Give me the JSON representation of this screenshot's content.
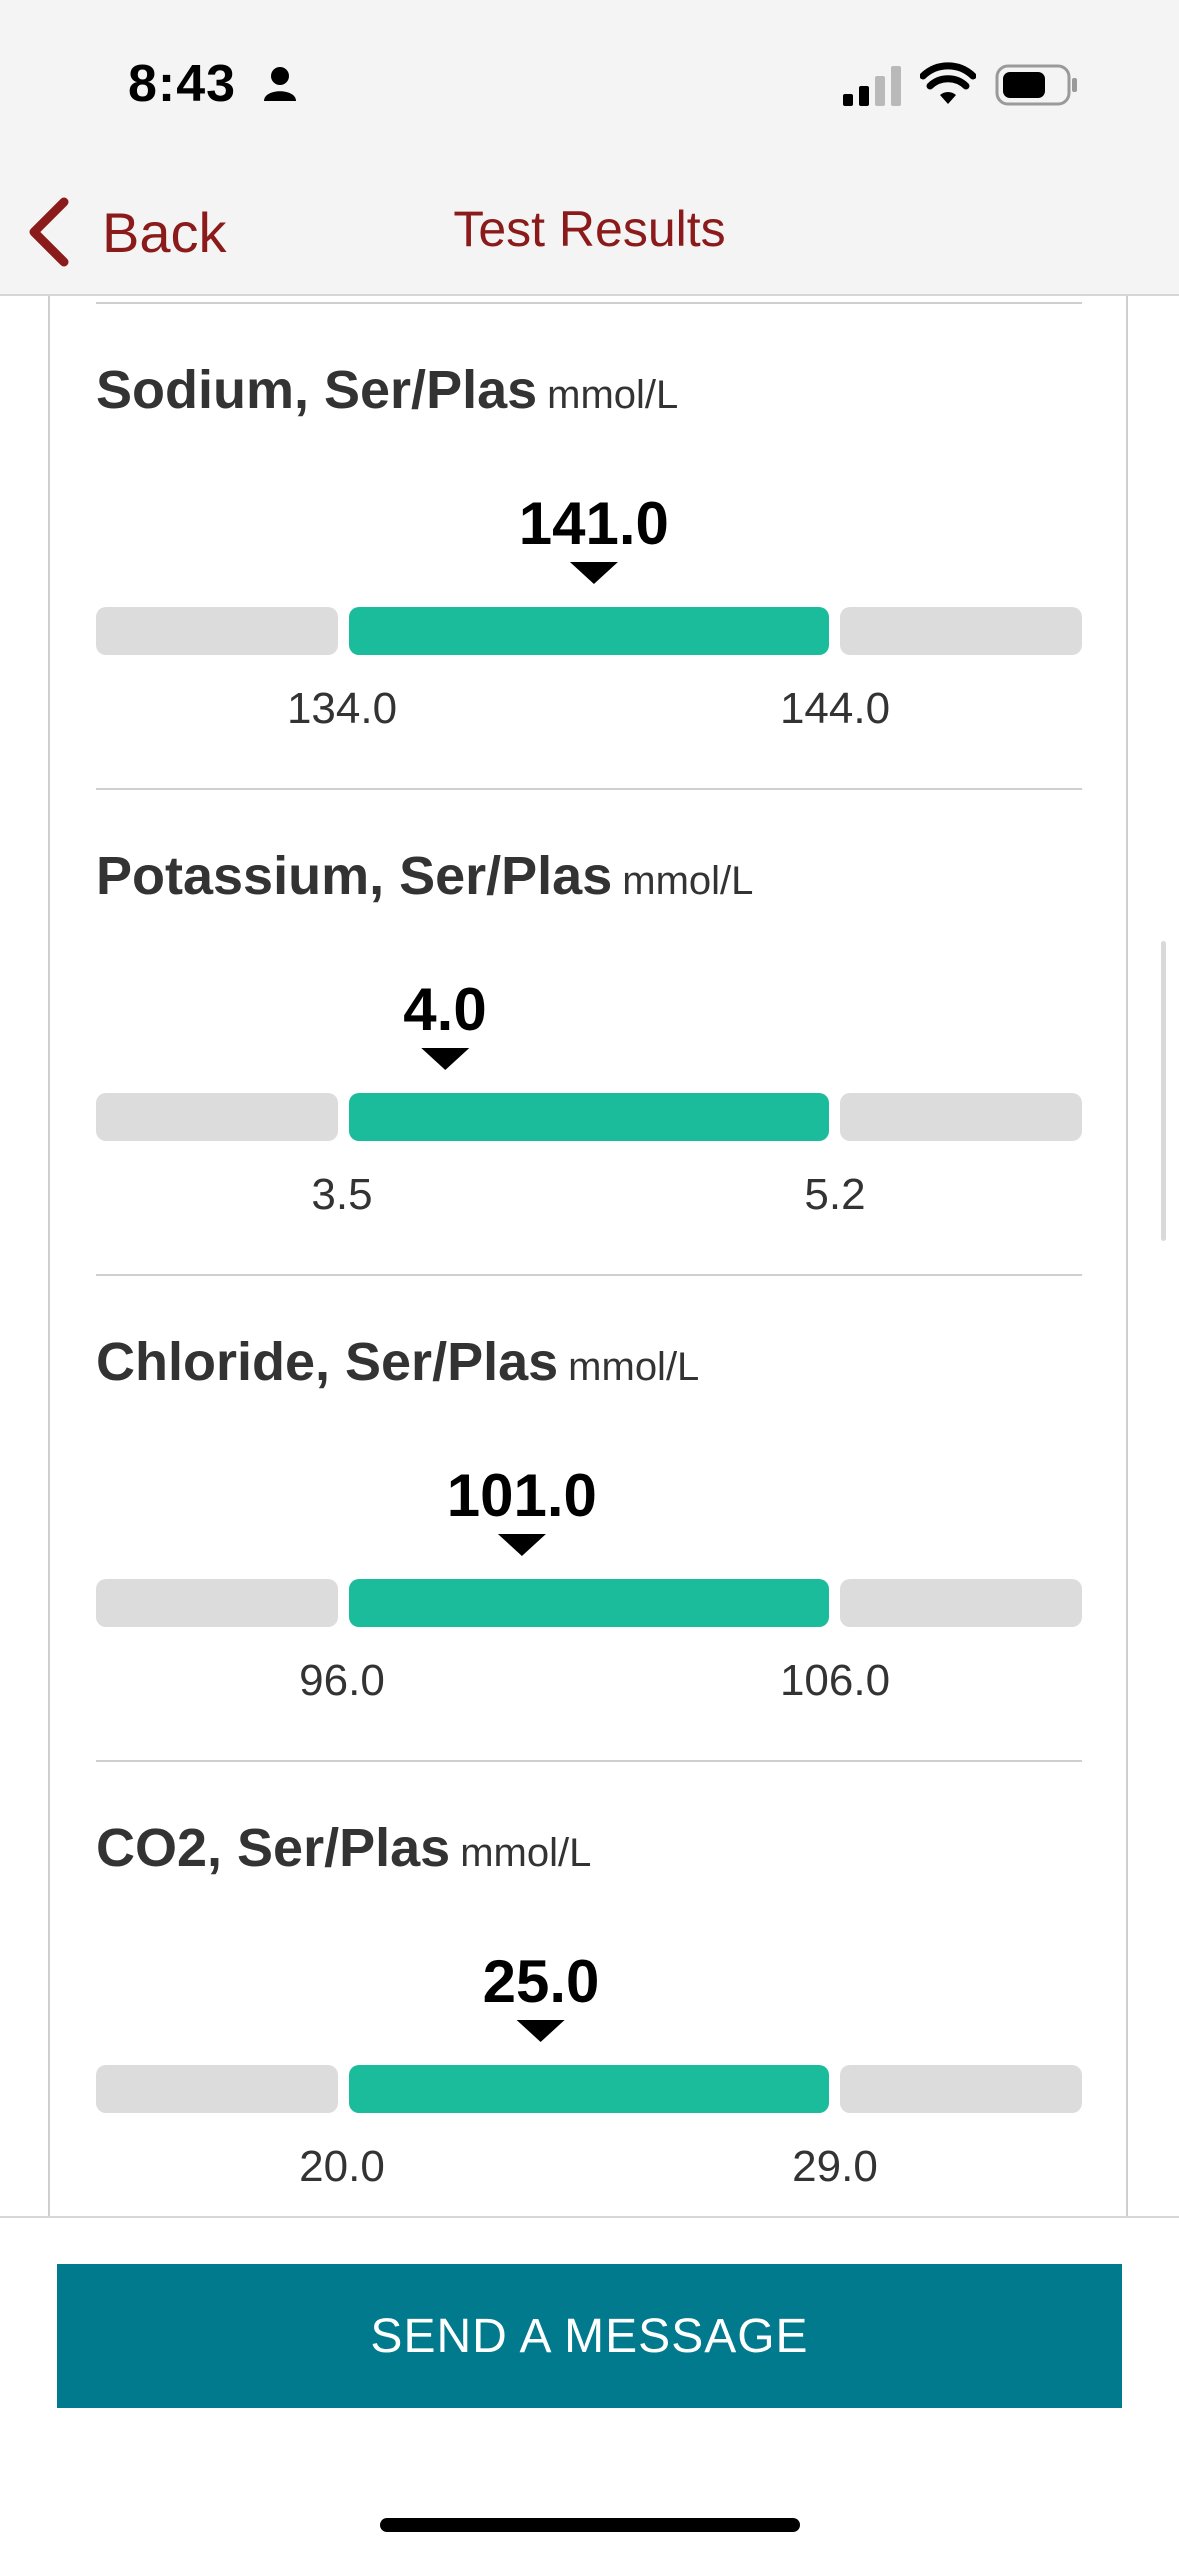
{
  "status_bar": {
    "time": "8:43"
  },
  "nav": {
    "back_label": "Back",
    "title": "Test Results"
  },
  "results": [
    {
      "name": "Sodium, Ser/Plas",
      "unit": "mmol/L",
      "value": "141.0",
      "low": "134.0",
      "high": "144.0",
      "value_position": 0.51
    },
    {
      "name": "Potassium, Ser/Plas",
      "unit": "mmol/L",
      "value": "4.0",
      "low": "3.5",
      "high": "5.2",
      "value_position": 0.2
    },
    {
      "name": "Chloride, Ser/Plas",
      "unit": "mmol/L",
      "value": "101.0",
      "low": "96.0",
      "high": "106.0",
      "value_position": 0.36
    },
    {
      "name": "CO2, Ser/Plas",
      "unit": "mmol/L",
      "value": "25.0",
      "low": "20.0",
      "high": "29.0",
      "value_position": 0.4
    }
  ],
  "footer": {
    "send_message_label": "SEND A MESSAGE"
  },
  "colors": {
    "accent": "#8b1a1a",
    "normal_range": "#1abc9c",
    "button": "#007a8c"
  }
}
